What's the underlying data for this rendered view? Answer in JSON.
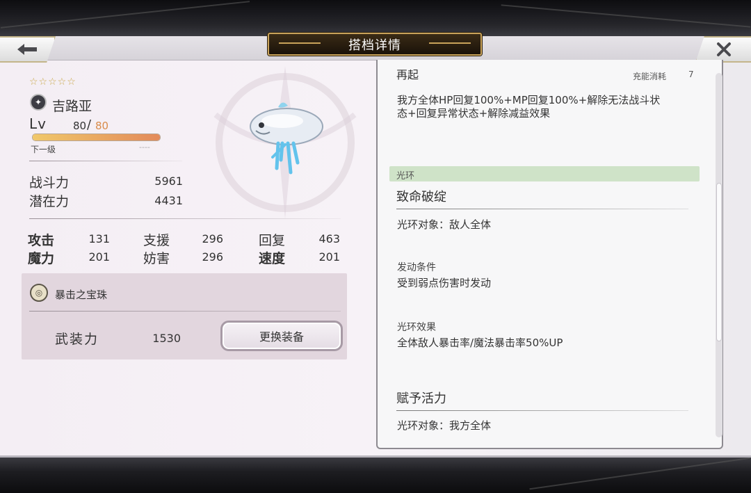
{
  "header": {
    "title": "搭档详情"
  },
  "character": {
    "stars": "☆☆☆☆☆",
    "element_icon": "dark-element-icon",
    "name": "吉路亚",
    "level_label": "Lv",
    "level_current": "80",
    "level_slash": "/",
    "level_max": "80",
    "level_progress": 1.0,
    "next_level_label": "下一级",
    "next_level_value": "----",
    "combat_power_label": "战斗力",
    "combat_power": "5961",
    "potential_label": "潜在力",
    "potential": "4431"
  },
  "stats": {
    "attack_label": "攻击",
    "attack": "131",
    "support_label": "支援",
    "support": "296",
    "recover_label": "回复",
    "recover": "463",
    "magic_label": "魔力",
    "magic": "201",
    "hinder_label": "妨害",
    "hinder": "296",
    "speed_label": "速度",
    "speed": "201"
  },
  "equipment": {
    "icon": "orb-icon",
    "name": "暴击之宝珠",
    "armed_power_label": "武装力",
    "armed_power": "1530",
    "change_button": "更换装备"
  },
  "skills": {
    "partial_title": "再起",
    "charge_label": "充能消耗",
    "charge_value": "7",
    "special_desc_line1": "我方全体HP回复100%+MP回复100%+解除无法战斗状",
    "special_desc_line2": "态+回复异常状态+解除减益效果",
    "aura_section": "光环",
    "aura1_name": "致命破绽",
    "aura1_target": "光环对象：敌人全体",
    "aura1_condition_label": "发动条件",
    "aura1_condition": "受到弱点伤害时发动",
    "aura1_effect_label": "光环效果",
    "aura1_effect": "全体敌人暴击率/魔法暴击率50%UP",
    "aura2_name": "赋予活力",
    "aura2_target": "光环对象：我方全体"
  },
  "colors": {
    "gold_accent": "#c9a35a",
    "level_max": "#d98b4a",
    "aura_header": "#cfe3c8"
  }
}
